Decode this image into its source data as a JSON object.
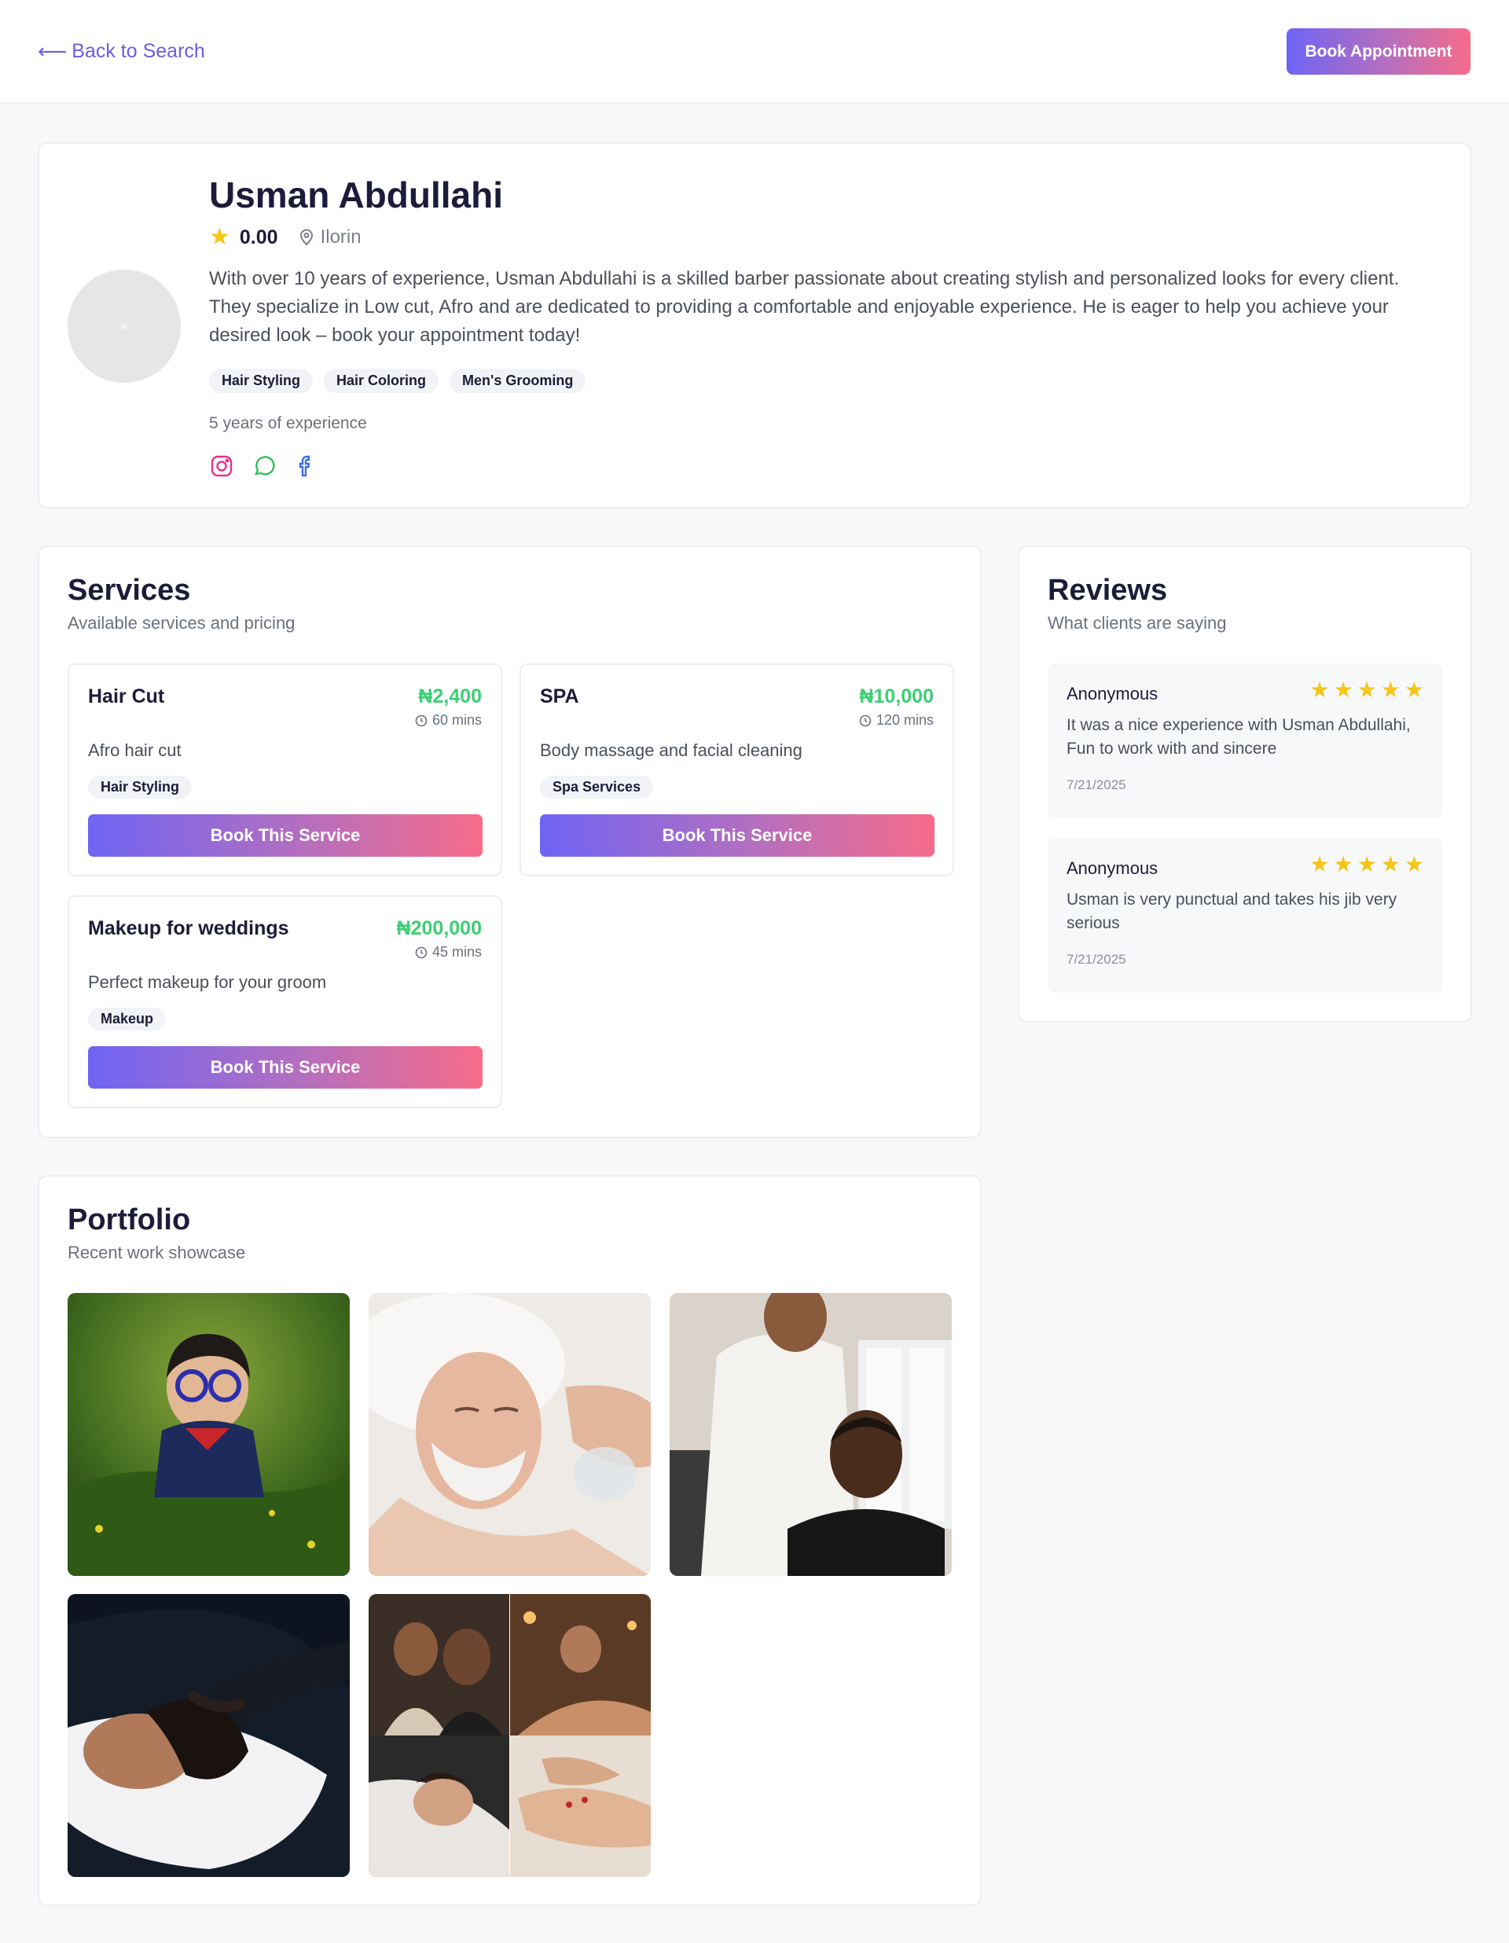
{
  "header": {
    "back_label": "Back to Search",
    "book_label": "Book Appointment"
  },
  "profile": {
    "name": "Usman Abdullahi",
    "rating": "0.00",
    "location": "Ilorin",
    "bio": "With over 10 years of experience, Usman Abdullahi is a skilled barber passionate about creating stylish and personalized looks for every client. They specialize in Low cut, Afro and are dedicated to providing a comfortable and enjoyable experience. He is eager to help you achieve your desired look – book your appointment today!",
    "tags": [
      "Hair Styling",
      "Hair Coloring",
      "Men's Grooming"
    ],
    "experience": "5 years of experience",
    "socials": [
      "instagram-icon",
      "whatsapp-icon",
      "facebook-icon"
    ]
  },
  "services": {
    "title": "Services",
    "subtitle": "Available services and pricing",
    "items": [
      {
        "name": "Hair Cut",
        "price": "₦2,400",
        "duration": "60 mins",
        "description": "Afro hair cut",
        "tag": "Hair Styling",
        "button": "Book This Service"
      },
      {
        "name": "SPA",
        "price": "₦10,000",
        "duration": "120 mins",
        "description": "Body massage and facial cleaning",
        "tag": "Spa Services",
        "button": "Book This Service"
      },
      {
        "name": "Makeup for weddings",
        "price": "₦200,000",
        "duration": "45 mins",
        "description": "Perfect makeup for your groom",
        "tag": "Makeup",
        "button": "Book This Service"
      }
    ]
  },
  "reviews": {
    "title": "Reviews",
    "subtitle": "What clients are saying",
    "items": [
      {
        "author": "Anonymous",
        "stars": 5,
        "text": "It was a nice experience with Usman Abdullahi, Fun to work with and sincere",
        "date": "7/21/2025"
      },
      {
        "author": "Anonymous",
        "stars": 5,
        "text": "Usman is very punctual and takes his jib very serious",
        "date": "7/21/2025"
      }
    ]
  },
  "portfolio": {
    "title": "Portfolio",
    "subtitle": "Recent work showcase"
  },
  "colors": {
    "accent": "#6a5de6",
    "gradient_start": "#6f64f4",
    "gradient_end": "#f76b8a",
    "price_green": "#3ccf74",
    "star_yellow": "#f5c518"
  }
}
